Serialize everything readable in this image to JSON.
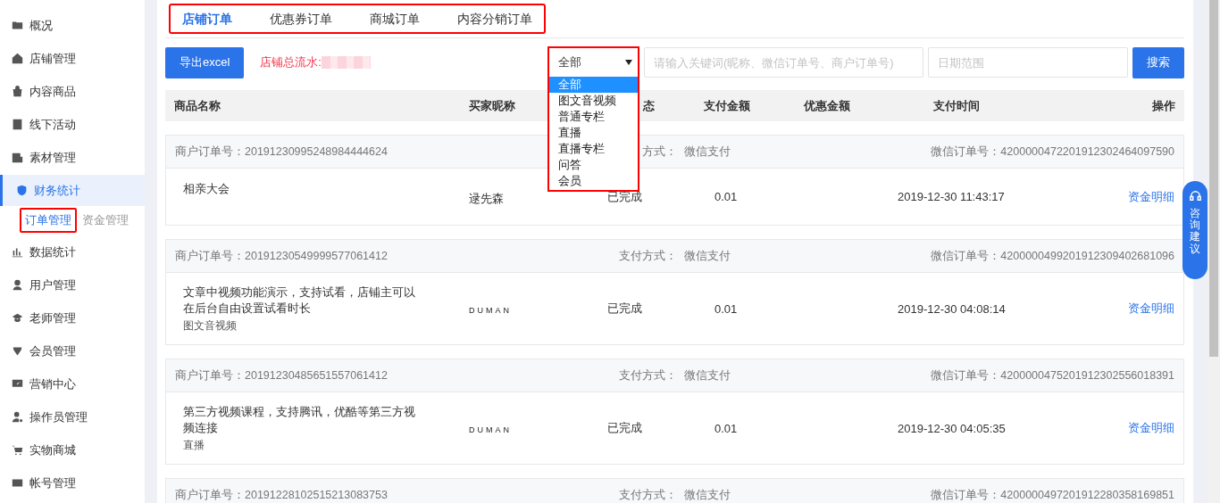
{
  "sidebar": {
    "items": [
      {
        "label": "概况",
        "selected": false
      },
      {
        "label": "店铺管理",
        "selected": false
      },
      {
        "label": "内容商品",
        "selected": false
      },
      {
        "label": "线下活动",
        "selected": false
      },
      {
        "label": "素材管理",
        "selected": false
      },
      {
        "label": "财务统计",
        "selected": true,
        "children": [
          {
            "label": "订单管理",
            "selected": true,
            "highlighted": true
          },
          {
            "label": "资金管理",
            "selected": false,
            "highlighted": false
          }
        ]
      },
      {
        "label": "数据统计",
        "selected": false
      },
      {
        "label": "用户管理",
        "selected": false
      },
      {
        "label": "老师管理",
        "selected": false
      },
      {
        "label": "会员管理",
        "selected": false
      },
      {
        "label": "营销中心",
        "selected": false
      },
      {
        "label": "操作员管理",
        "selected": false
      },
      {
        "label": "实物商城",
        "selected": false
      },
      {
        "label": "帐号管理",
        "selected": false
      }
    ]
  },
  "tabs": {
    "highlighted": true,
    "items": [
      {
        "label": "店铺订单",
        "selected": true
      },
      {
        "label": "优惠券订单",
        "selected": false
      },
      {
        "label": "商城订单",
        "selected": false
      },
      {
        "label": "内容分销订单",
        "selected": false
      }
    ]
  },
  "toolbar": {
    "export_button": "导出excel",
    "flow_label": "店铺总流水:",
    "flow_redacted": true,
    "type_select": {
      "value": "全部",
      "highlighted": true,
      "expanded": true,
      "options": [
        {
          "label": "全部",
          "selected": true
        },
        {
          "label": "图文音视频",
          "selected": false
        },
        {
          "label": "普通专栏",
          "selected": false
        },
        {
          "label": "直播",
          "selected": false
        },
        {
          "label": "直播专栏",
          "selected": false
        },
        {
          "label": "问答",
          "selected": false
        },
        {
          "label": "会员",
          "selected": false
        }
      ]
    },
    "keyword_field": {
      "placeholder": "请输入关键词(昵称、微信订单号、商户订单号)"
    },
    "date_field": {
      "placeholder": "日期范围"
    },
    "search_button": "搜索"
  },
  "table": {
    "columns": [
      "商品名称",
      "买家昵称",
      "态",
      "支付金额",
      "优惠金额",
      "支付时间",
      "操作"
    ],
    "orders": [
      {
        "merchant_no": "商户订单号：20191230995248984444624",
        "pay_label": "方式：",
        "pay_method": "微信支付",
        "wechat_no": "微信订单号：4200000472201912302464097590",
        "product": "相亲大会",
        "buyer": "逯先森",
        "buyer_spaced": false,
        "status": "已完成",
        "amount": "0.01",
        "time": "2019-12-30 11:43:17",
        "action": "资金明细"
      },
      {
        "merchant_no": "商户订单号：20191230549999577061412",
        "pay_label": "支付方式：",
        "pay_method": "微信支付",
        "wechat_no": "微信订单号：4200000499201912309402681096",
        "product": "文章中视频功能演示，支持试看，店铺主可以在后台自由设置试看时长",
        "category": "图文音视频",
        "buyer": "DUMAN",
        "buyer_spaced": true,
        "status": "已完成",
        "amount": "0.01",
        "time": "2019-12-30 04:08:14",
        "action": "资金明细"
      },
      {
        "merchant_no": "商户订单号：20191230485651557061412",
        "pay_label": "支付方式：",
        "pay_method": "微信支付",
        "wechat_no": "微信订单号：4200000475201912302556018391",
        "product": "第三方视频课程，支持腾讯，优酷等第三方视频连接",
        "category": "直播",
        "buyer": "DUMAN",
        "buyer_spaced": true,
        "status": "已完成",
        "amount": "0.01",
        "time": "2019-12-30 04:05:35",
        "action": "资金明细"
      },
      {
        "merchant_no": "商户订单号：20191228102515213083753",
        "pay_label": "支付方式：",
        "pay_method": "微信支付",
        "wechat_no": "微信订单号：4200000497201912280358169851"
      }
    ]
  },
  "consult_button": "咨询建议"
}
